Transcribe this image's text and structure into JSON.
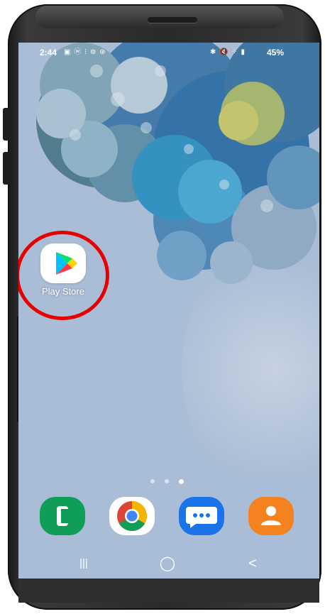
{
  "status_bar": {
    "time": "2:44",
    "left_icons": "▣ ⓦ ⁝ ⊚ ⊛",
    "right_icons": "✱ 🔇 ⁘ ▮",
    "battery": "45%"
  },
  "home_screen": {
    "apps": [
      {
        "label": "Play Store",
        "icon": "play-store-icon"
      }
    ],
    "page_indicator": {
      "pages": 3,
      "current": 3
    }
  },
  "dock": [
    {
      "icon": "phone-icon",
      "color": "#0f9d58"
    },
    {
      "icon": "chrome-icon",
      "color": "#ffffff"
    },
    {
      "icon": "messages-icon",
      "color": "#1a73e8"
    },
    {
      "icon": "contacts-icon",
      "color": "#f4821f"
    }
  ],
  "nav_bar": {
    "recents_glyph": "|||",
    "home_glyph": "◯",
    "back_glyph": "<"
  },
  "colors": {
    "highlight": "#e60000",
    "wallpaper": "#aabdd6"
  }
}
